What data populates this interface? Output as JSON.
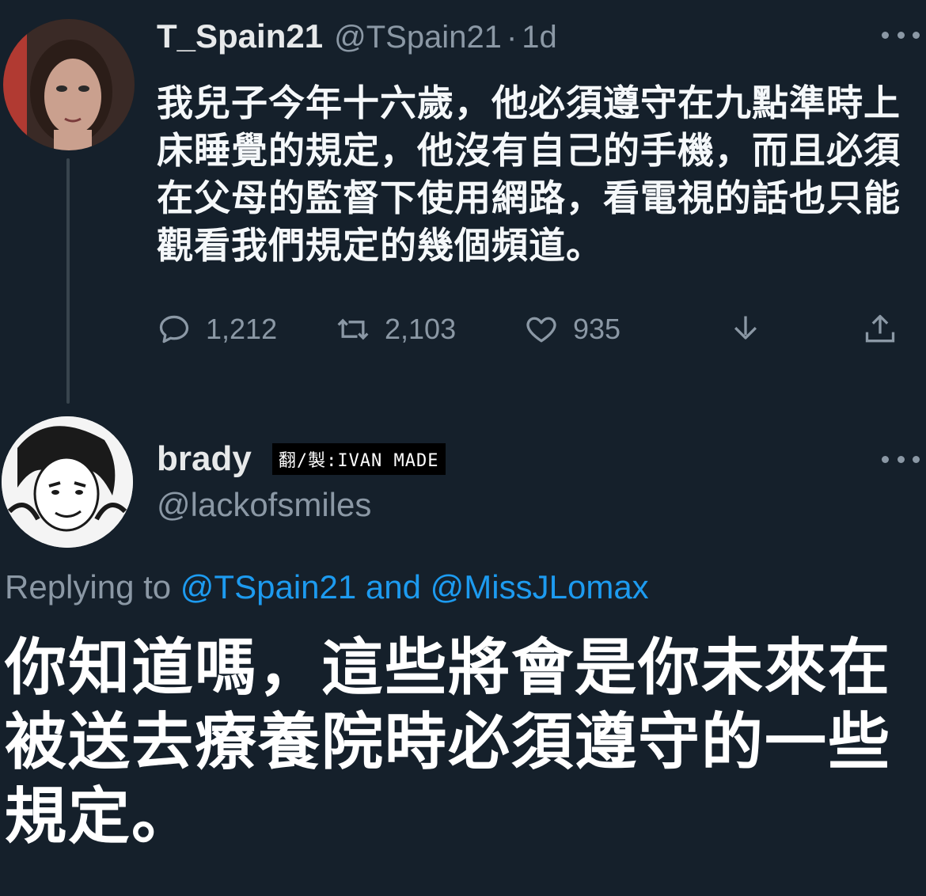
{
  "tweet": {
    "author_name": "T_Spain21",
    "author_handle": "@TSpain21",
    "separator": "·",
    "time": "1d",
    "avatar_icon": "woman-portrait-avatar",
    "text": "我兒子今年十六歲，他必須遵守在九點準時上床睡覺的規定，他沒有自己的手機，而且必須在父母的監督下使用網路，看電視的話也只能觀看我們規定的幾個頻道。",
    "actions": {
      "reply_icon": "comment-icon",
      "reply_count": "1,212",
      "retweet_icon": "retweet-icon",
      "retweet_count": "2,103",
      "like_icon": "heart-icon",
      "like_count": "935",
      "share_icon": "share-down-icon",
      "upload_icon": "upload-icon"
    }
  },
  "reply": {
    "author_name": "brady",
    "watermark": "翻/製:IVAN MADE",
    "author_handle": "@lackofsmiles",
    "avatar_icon": "manga-character-avatar",
    "replying_prefix": "Replying to",
    "replying_to_1": "@TSpain21",
    "replying_and": "and",
    "replying_to_2": "@MissJLomax",
    "text": "你知道嗎，這些將會是你未來在被送去療養院時必須遵守的一些規定。"
  },
  "colors": {
    "background": "#15202b",
    "primary_text": "#e7e9ea",
    "secondary_text": "#8b98a5",
    "link": "#1d9bf0"
  }
}
